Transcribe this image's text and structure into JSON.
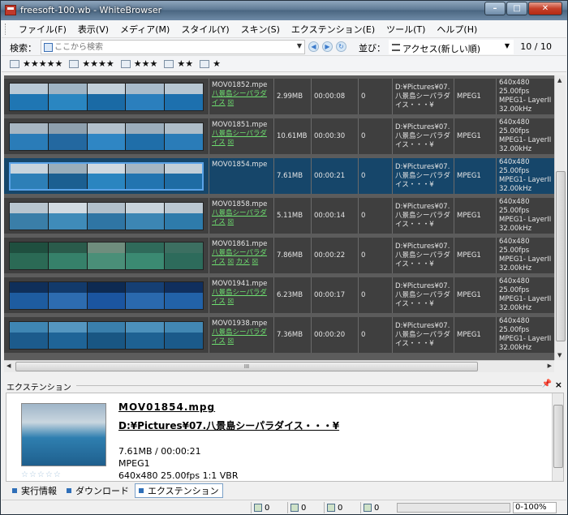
{
  "window": {
    "title": "freesoft-100.wb - WhiteBrowser"
  },
  "menu": [
    "ファイル(F)",
    "表示(V)",
    "メディア(M)",
    "スタイル(Y)",
    "スキン(S)",
    "エクステンション(E)",
    "ツール(T)",
    "ヘルプ(H)"
  ],
  "toolbar": {
    "search_label": "検索：",
    "search_placeholder": "ここから検索",
    "sort_label": "並び：",
    "sort_value": "アクセス(新しい順)",
    "count": "10 / 10"
  },
  "rating_filters": [
    "★★★★★",
    "★★★★",
    "★★★",
    "★★",
    "★"
  ],
  "rows": [
    {
      "name": "MOV01852.mpe",
      "tags": [
        "八景島シーパラダイス",
        "☒"
      ],
      "size": "2.99MB",
      "duration": "00:00:08",
      "score": "0",
      "path": "D:¥Pictures¥07.八景島シーパラダイス・・・¥",
      "codec": "MPEG1",
      "info": "640x480 25.00fps MPEG1- LayerII 32.00kHz",
      "selected": false
    },
    {
      "name": "MOV01851.mpe",
      "tags": [
        "八景島シーパラダイス",
        "☒"
      ],
      "size": "10.61MB",
      "duration": "00:00:30",
      "score": "0",
      "path": "D:¥Pictures¥07.八景島シーパラダイス・・・¥",
      "codec": "MPEG1",
      "info": "640x480 25.00fps MPEG1- LayerII 32.00kHz",
      "selected": false
    },
    {
      "name": "MOV01854.mpe",
      "tags": [],
      "size": "7.61MB",
      "duration": "00:00:21",
      "score": "0",
      "path": "D:¥Pictures¥07.八景島シーパラダイス・・・¥",
      "codec": "MPEG1",
      "info": "640x480 25.00fps MPEG1- LayerII 32.00kHz",
      "selected": true
    },
    {
      "name": "MOV01858.mpe",
      "tags": [
        "八景島シーパラダイス",
        "☒"
      ],
      "size": "5.11MB",
      "duration": "00:00:14",
      "score": "0",
      "path": "D:¥Pictures¥07.八景島シーパラダイス・・・¥",
      "codec": "MPEG1",
      "info": "640x480 25.00fps MPEG1- LayerII 32.00kHz",
      "selected": false
    },
    {
      "name": "MOV01861.mpe",
      "tags": [
        "八景島シーパラダイス",
        "☒",
        "カメ",
        "☒"
      ],
      "size": "7.86MB",
      "duration": "00:00:22",
      "score": "0",
      "path": "D:¥Pictures¥07.八景島シーパラダイス・・・¥",
      "codec": "MPEG1",
      "info": "640x480 25.00fps MPEG1- LayerII 32.00kHz",
      "selected": false
    },
    {
      "name": "MOV01941.mpe",
      "tags": [
        "八景島シーパラダイス",
        "☒"
      ],
      "size": "6.23MB",
      "duration": "00:00:17",
      "score": "0",
      "path": "D:¥Pictures¥07.八景島シーパラダイス・・・¥",
      "codec": "MPEG1",
      "info": "640x480 25.00fps MPEG1- LayerII 32.00kHz",
      "selected": false
    },
    {
      "name": "MOV01938.mpe",
      "tags": [
        "八景島シーパラダイス",
        "☒"
      ],
      "size": "7.36MB",
      "duration": "00:00:20",
      "score": "0",
      "path": "D:¥Pictures¥07.八景島シーパラダイス・・・¥",
      "codec": "MPEG1",
      "info": "640x480 25.00fps MPEG1- LayerII 32.00kHz",
      "selected": false
    }
  ],
  "extension": {
    "header": "エクステンション",
    "filename": "MOV01854.mpg",
    "path": "D:¥Pictures¥07.八景島シーパラダイス・・・¥",
    "size_duration": "7.61MB / 00:00:21",
    "codec": "MPEG1",
    "video_info": "640x480 25.00fps 1:1 VBR",
    "stars": "☆☆☆☆☆"
  },
  "tabs": [
    "実行情報",
    "ダウンロード",
    "エクステンション"
  ],
  "status": {
    "counts": [
      "0",
      "0",
      "0",
      "0"
    ],
    "percent": "0-100%"
  }
}
